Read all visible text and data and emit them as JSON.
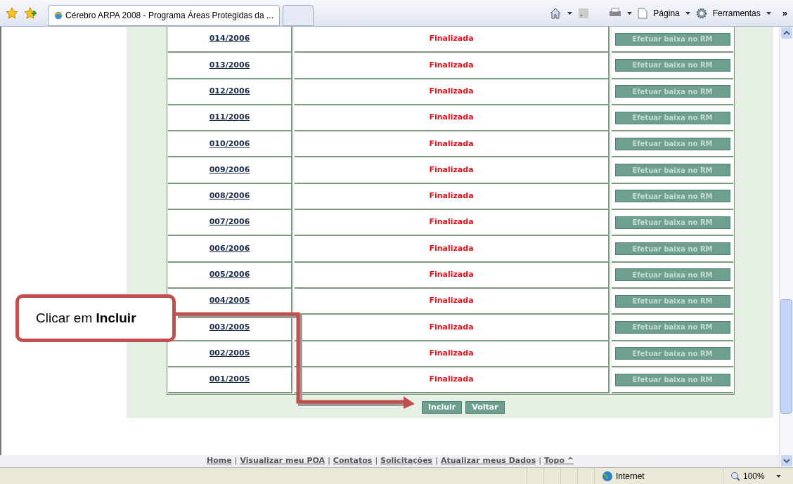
{
  "browser": {
    "tabs": [
      {
        "title": "Cérebro ARPA 2008 - Programa Áreas Protegidas da ...",
        "selected": true
      },
      {
        "selected": false
      }
    ],
    "toolbar": [
      "Página",
      "Ferramentas"
    ],
    "overflow": "»"
  },
  "table": {
    "rows": [
      {
        "number": "014/2006",
        "status": "Finalizada",
        "action": "Efetuar baixa no RM"
      },
      {
        "number": "013/2006",
        "status": "Finalizada",
        "action": "Efetuar baixa no RM"
      },
      {
        "number": "012/2006",
        "status": "Finalizada",
        "action": "Efetuar baixa no RM"
      },
      {
        "number": "011/2006",
        "status": "Finalizada",
        "action": "Efetuar baixa no RM"
      },
      {
        "number": "010/2006",
        "status": "Finalizada",
        "action": "Efetuar baixa no RM"
      },
      {
        "number": "009/2006",
        "status": "Finalizada",
        "action": "Efetuar baixa no RM"
      },
      {
        "number": "008/2006",
        "status": "Finalizada",
        "action": "Efetuar baixa no RM"
      },
      {
        "number": "007/2006",
        "status": "Finalizada",
        "action": "Efetuar baixa no RM"
      },
      {
        "number": "006/2006",
        "status": "Finalizada",
        "action": "Efetuar baixa no RM"
      },
      {
        "number": "005/2006",
        "status": "Finalizada",
        "action": "Efetuar baixa no RM"
      },
      {
        "number": "004/2005",
        "status": "Finalizada",
        "action": "Efetuar baixa no RM"
      },
      {
        "number": "003/2005",
        "status": "Finalizada",
        "action": "Efetuar baixa no RM"
      },
      {
        "number": "002/2005",
        "status": "Finalizada",
        "action": "Efetuar baixa no RM"
      },
      {
        "number": "001/2005",
        "status": "Finalizada",
        "action": "Efetuar baixa no RM"
      }
    ]
  },
  "buttons": [
    "Incluir",
    "Voltar"
  ],
  "callout": {
    "text": "Clicar em **Incluir**"
  },
  "footer": {
    "links": [
      "Home",
      "Visualizar meu POA",
      "Contatos",
      "Solicitações",
      "Atualizar meus Dados",
      "Topo ^"
    ],
    "separator": "|"
  },
  "status_bar": {
    "zone": "Internet",
    "zoom": "100%"
  }
}
